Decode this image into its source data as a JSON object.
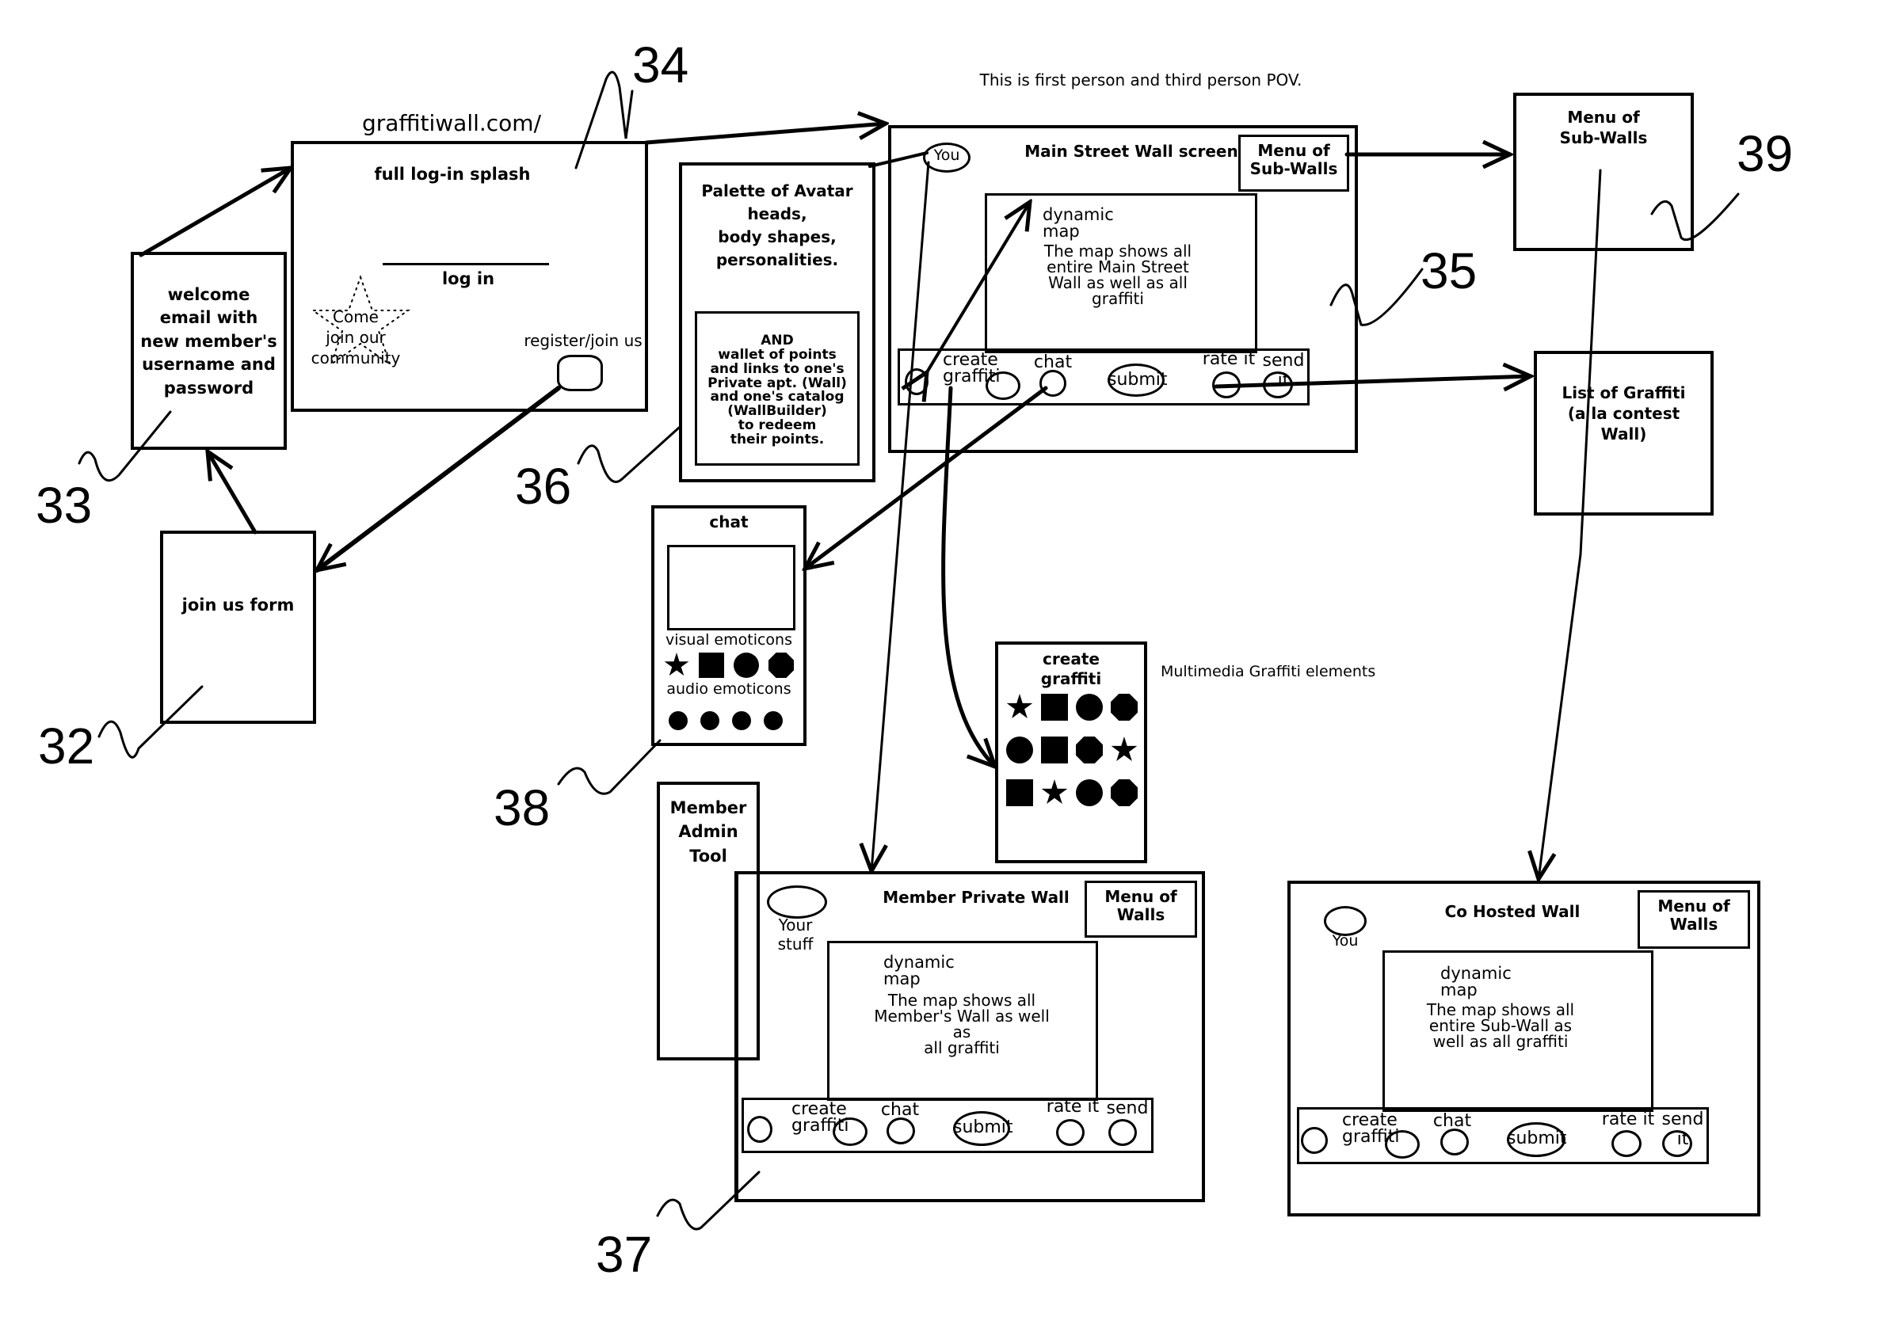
{
  "header_note": "This is first person and third person POV.",
  "url_label": "graffitiwall.com/",
  "ref_numbers": {
    "n32": "32",
    "n33": "33",
    "n34": "34",
    "n35": "35",
    "n36": "36",
    "n37": "37",
    "n38": "38",
    "n39": "39"
  },
  "join_form": {
    "title": "join us form"
  },
  "welcome_email": {
    "text": "welcome\nemail with\nnew member's\nusername and\npassword"
  },
  "login_splash": {
    "title": "full log-in splash",
    "login_label": "log in",
    "community_text": "Come\njoin our\ncommunity",
    "register_label": "register/join us"
  },
  "avatar_palette": {
    "title": "Palette of Avatar\nheads,\nbody shapes,\npersonalities.",
    "wallet_text": "AND\nwallet of points\nand links to one's\nPrivate apt. (Wall)\nand one's catalog\n(WallBuilder)\nto redeem\ntheir points."
  },
  "main_street_wall": {
    "title": "Main Street Wall screen",
    "you_label": "You",
    "menu_label": "Menu of\nSub-Walls",
    "map_title": "dynamic\n   map",
    "map_desc": "The map shows all\nentire Main Street\nWall as well as all graffiti",
    "toolbar": {
      "create": "create\ngraffiti",
      "chat": "chat",
      "submit": "submit",
      "rate": "rate it",
      "send": "send it"
    }
  },
  "menu_subwalls": {
    "title": "Menu of\nSub-Walls"
  },
  "list_graffiti": {
    "title": "List of Graffiti\n(a la contest\nWall)"
  },
  "chat_panel": {
    "title": "chat",
    "visual_label": "visual emoticons",
    "audio_label": "audio emoticons",
    "visual_icons": [
      "star-icon",
      "square-icon",
      "circle-icon",
      "octagon-icon"
    ],
    "audio_icons": [
      "circle-icon",
      "circle-icon",
      "circle-icon",
      "circle-icon"
    ]
  },
  "create_graffiti": {
    "title": "create\ngraffiti",
    "note": "Multimedia Graffiti elements",
    "rows": [
      [
        "star-icon",
        "square-icon",
        "circle-icon",
        "octagon-icon"
      ],
      [
        "circle-icon",
        "square-icon",
        "octagon-icon",
        "star-icon"
      ],
      [
        "square-icon",
        "star-icon",
        "circle-icon",
        "octagon-icon"
      ]
    ]
  },
  "member_admin": {
    "title": "Member\nAdmin\nTool"
  },
  "member_private_wall": {
    "title": "Member Private Wall",
    "your_stuff": "Your\nstuff",
    "menu_label": "Menu of\nWalls",
    "map_title": "dynamic\n   map",
    "map_desc": "The map shows all\nMember's Wall as well as\nall graffiti",
    "toolbar": {
      "create": "create\ngraffiti",
      "chat": "chat",
      "submit": "submit",
      "rate": "rate it",
      "send": "send it"
    }
  },
  "co_hosted_wall": {
    "title": "Co Hosted Wall",
    "you_label": "You",
    "menu_label": "Menu of\nWalls",
    "map_title": "dynamic\n   map",
    "map_desc": "The map shows all\nentire Sub-Wall as\nwell as all graffiti",
    "toolbar": {
      "create": "create\ngraffiti",
      "chat": "chat",
      "submit": "submit",
      "rate": "rate it",
      "send": "send it"
    }
  }
}
